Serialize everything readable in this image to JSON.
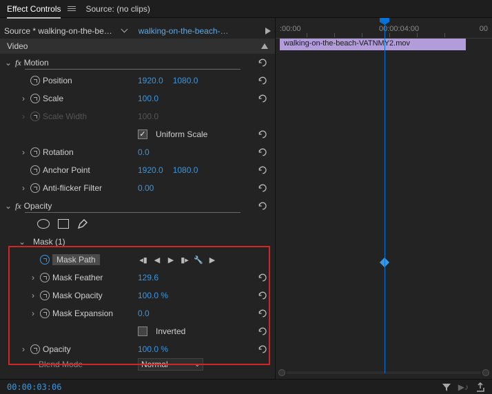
{
  "tabs": {
    "effect_controls": "Effect Controls",
    "source": "Source:",
    "no_clips": "(no clips)"
  },
  "source_row": {
    "prefix": "Source *",
    "clip": "walking-on-the-be…",
    "sequence_prefix": "",
    "sequence": "walking-on-the-beach-…"
  },
  "section": {
    "video": "Video"
  },
  "effects": {
    "motion": "Motion",
    "opacity": "Opacity"
  },
  "mask": {
    "title": "Mask (1)",
    "path": "Mask Path",
    "feather": {
      "label": "Mask Feather",
      "value": "129.6"
    },
    "opacity": {
      "label": "Mask Opacity",
      "value": "100.0 %"
    },
    "expansion": {
      "label": "Mask Expansion",
      "value": "0.0"
    },
    "inverted": "Inverted"
  },
  "props": {
    "position": {
      "label": "Position",
      "x": "1920.0",
      "y": "1080.0"
    },
    "scale": {
      "label": "Scale",
      "value": "100.0"
    },
    "scale_width": {
      "label": "Scale Width",
      "value": "100.0"
    },
    "uniform": "Uniform Scale",
    "rotation": {
      "label": "Rotation",
      "value": "0.0"
    },
    "anchor": {
      "label": "Anchor Point",
      "x": "1920.0",
      "y": "1080.0"
    },
    "antiflicker": {
      "label": "Anti-flicker Filter",
      "value": "0.00"
    },
    "opacity": {
      "label": "Opacity",
      "value": "100.0 %"
    },
    "blend": {
      "label": "Blend Mode",
      "value": "Normal"
    }
  },
  "timeline": {
    "t0": ":00:00",
    "t1": "00:00:04:00",
    "t2": "00",
    "clip_name": "walking-on-the-beach-VATNMY2.mov"
  },
  "footer": {
    "timecode": "00:00:03:06"
  },
  "icons": {
    "prev_kf": "◀|",
    "prev": "◀",
    "play": "▶",
    "next": "|▶",
    "wrench": "🔧",
    "go": "▶"
  }
}
